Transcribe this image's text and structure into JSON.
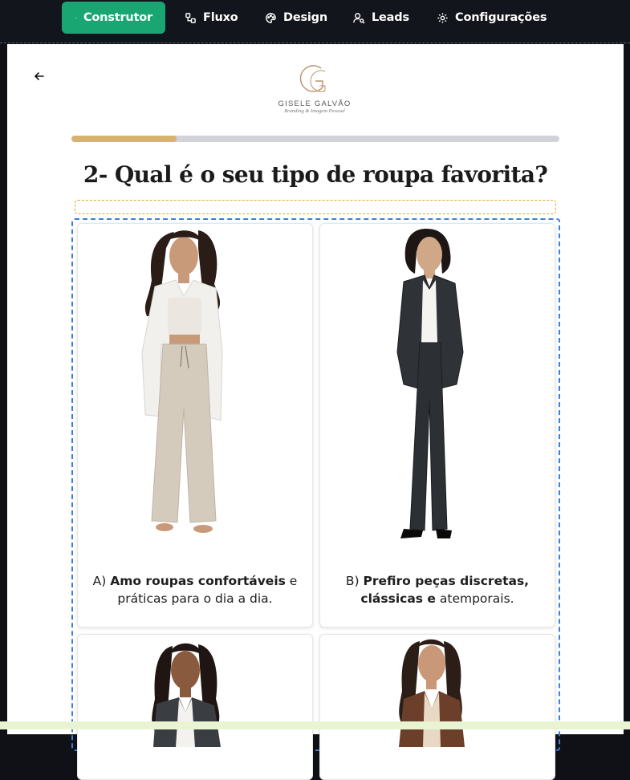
{
  "nav": {
    "items": [
      {
        "label": "Construtor",
        "icon": "sparkle-icon",
        "active": true
      },
      {
        "label": "Fluxo",
        "icon": "flow-icon"
      },
      {
        "label": "Design",
        "icon": "palette-icon"
      },
      {
        "label": "Leads",
        "icon": "user-search-icon"
      },
      {
        "label": "Configurações",
        "icon": "gear-icon"
      }
    ]
  },
  "colors": {
    "accent": "#1aa673",
    "progress": "#d8b272",
    "selection": "#3b7fd6",
    "placeholder": "#e0a830"
  },
  "brand": {
    "name": "GISELE GALVÃO",
    "tagline": "Branding & Imagem Pessoal"
  },
  "progress": {
    "fraction": 0.215
  },
  "question": {
    "title": "2- Qual é o seu tipo de roupa favorita?"
  },
  "options": [
    {
      "prefix": "A) ",
      "bold": "Amo roupas confortáveis",
      "rest": " e práticas para o dia a dia."
    },
    {
      "prefix": "B) ",
      "bold": "Prefiro peças discretas, clássicas e",
      "rest": " atemporais."
    },
    {
      "prefix": "",
      "bold": "",
      "rest": ""
    },
    {
      "prefix": "",
      "bold": "",
      "rest": ""
    }
  ]
}
